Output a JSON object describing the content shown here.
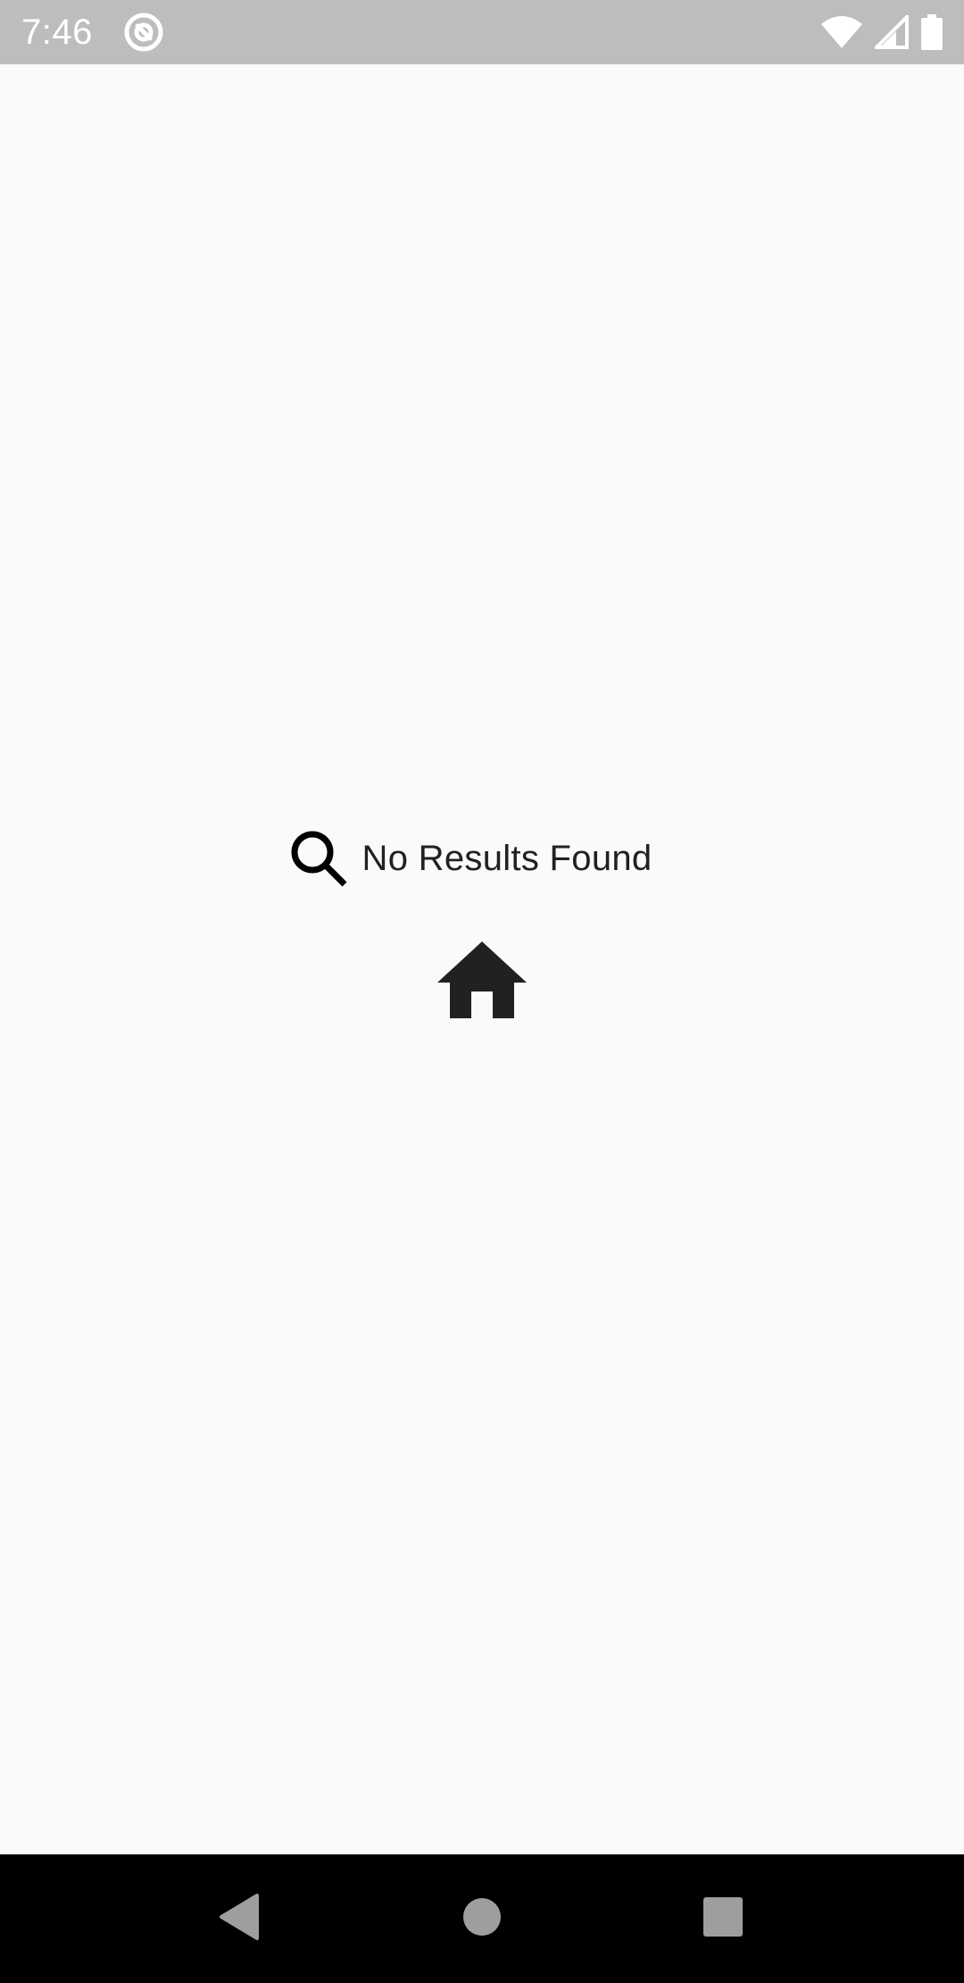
{
  "status_bar": {
    "time": "7:46",
    "app_icon": "at-sign-icon",
    "icons": [
      "wifi-icon",
      "cell-signal-icon",
      "battery-icon"
    ],
    "background_color": "#bdbdbd"
  },
  "empty_state": {
    "icon": "search-icon",
    "message": "No Results Found",
    "home_button_icon": "home-icon"
  },
  "navigation_bar": {
    "buttons": [
      "back",
      "home",
      "recents"
    ],
    "background_color": "#000000"
  },
  "colors": {
    "background": "#fafafa",
    "text": "#212121",
    "icon": "#212121"
  }
}
